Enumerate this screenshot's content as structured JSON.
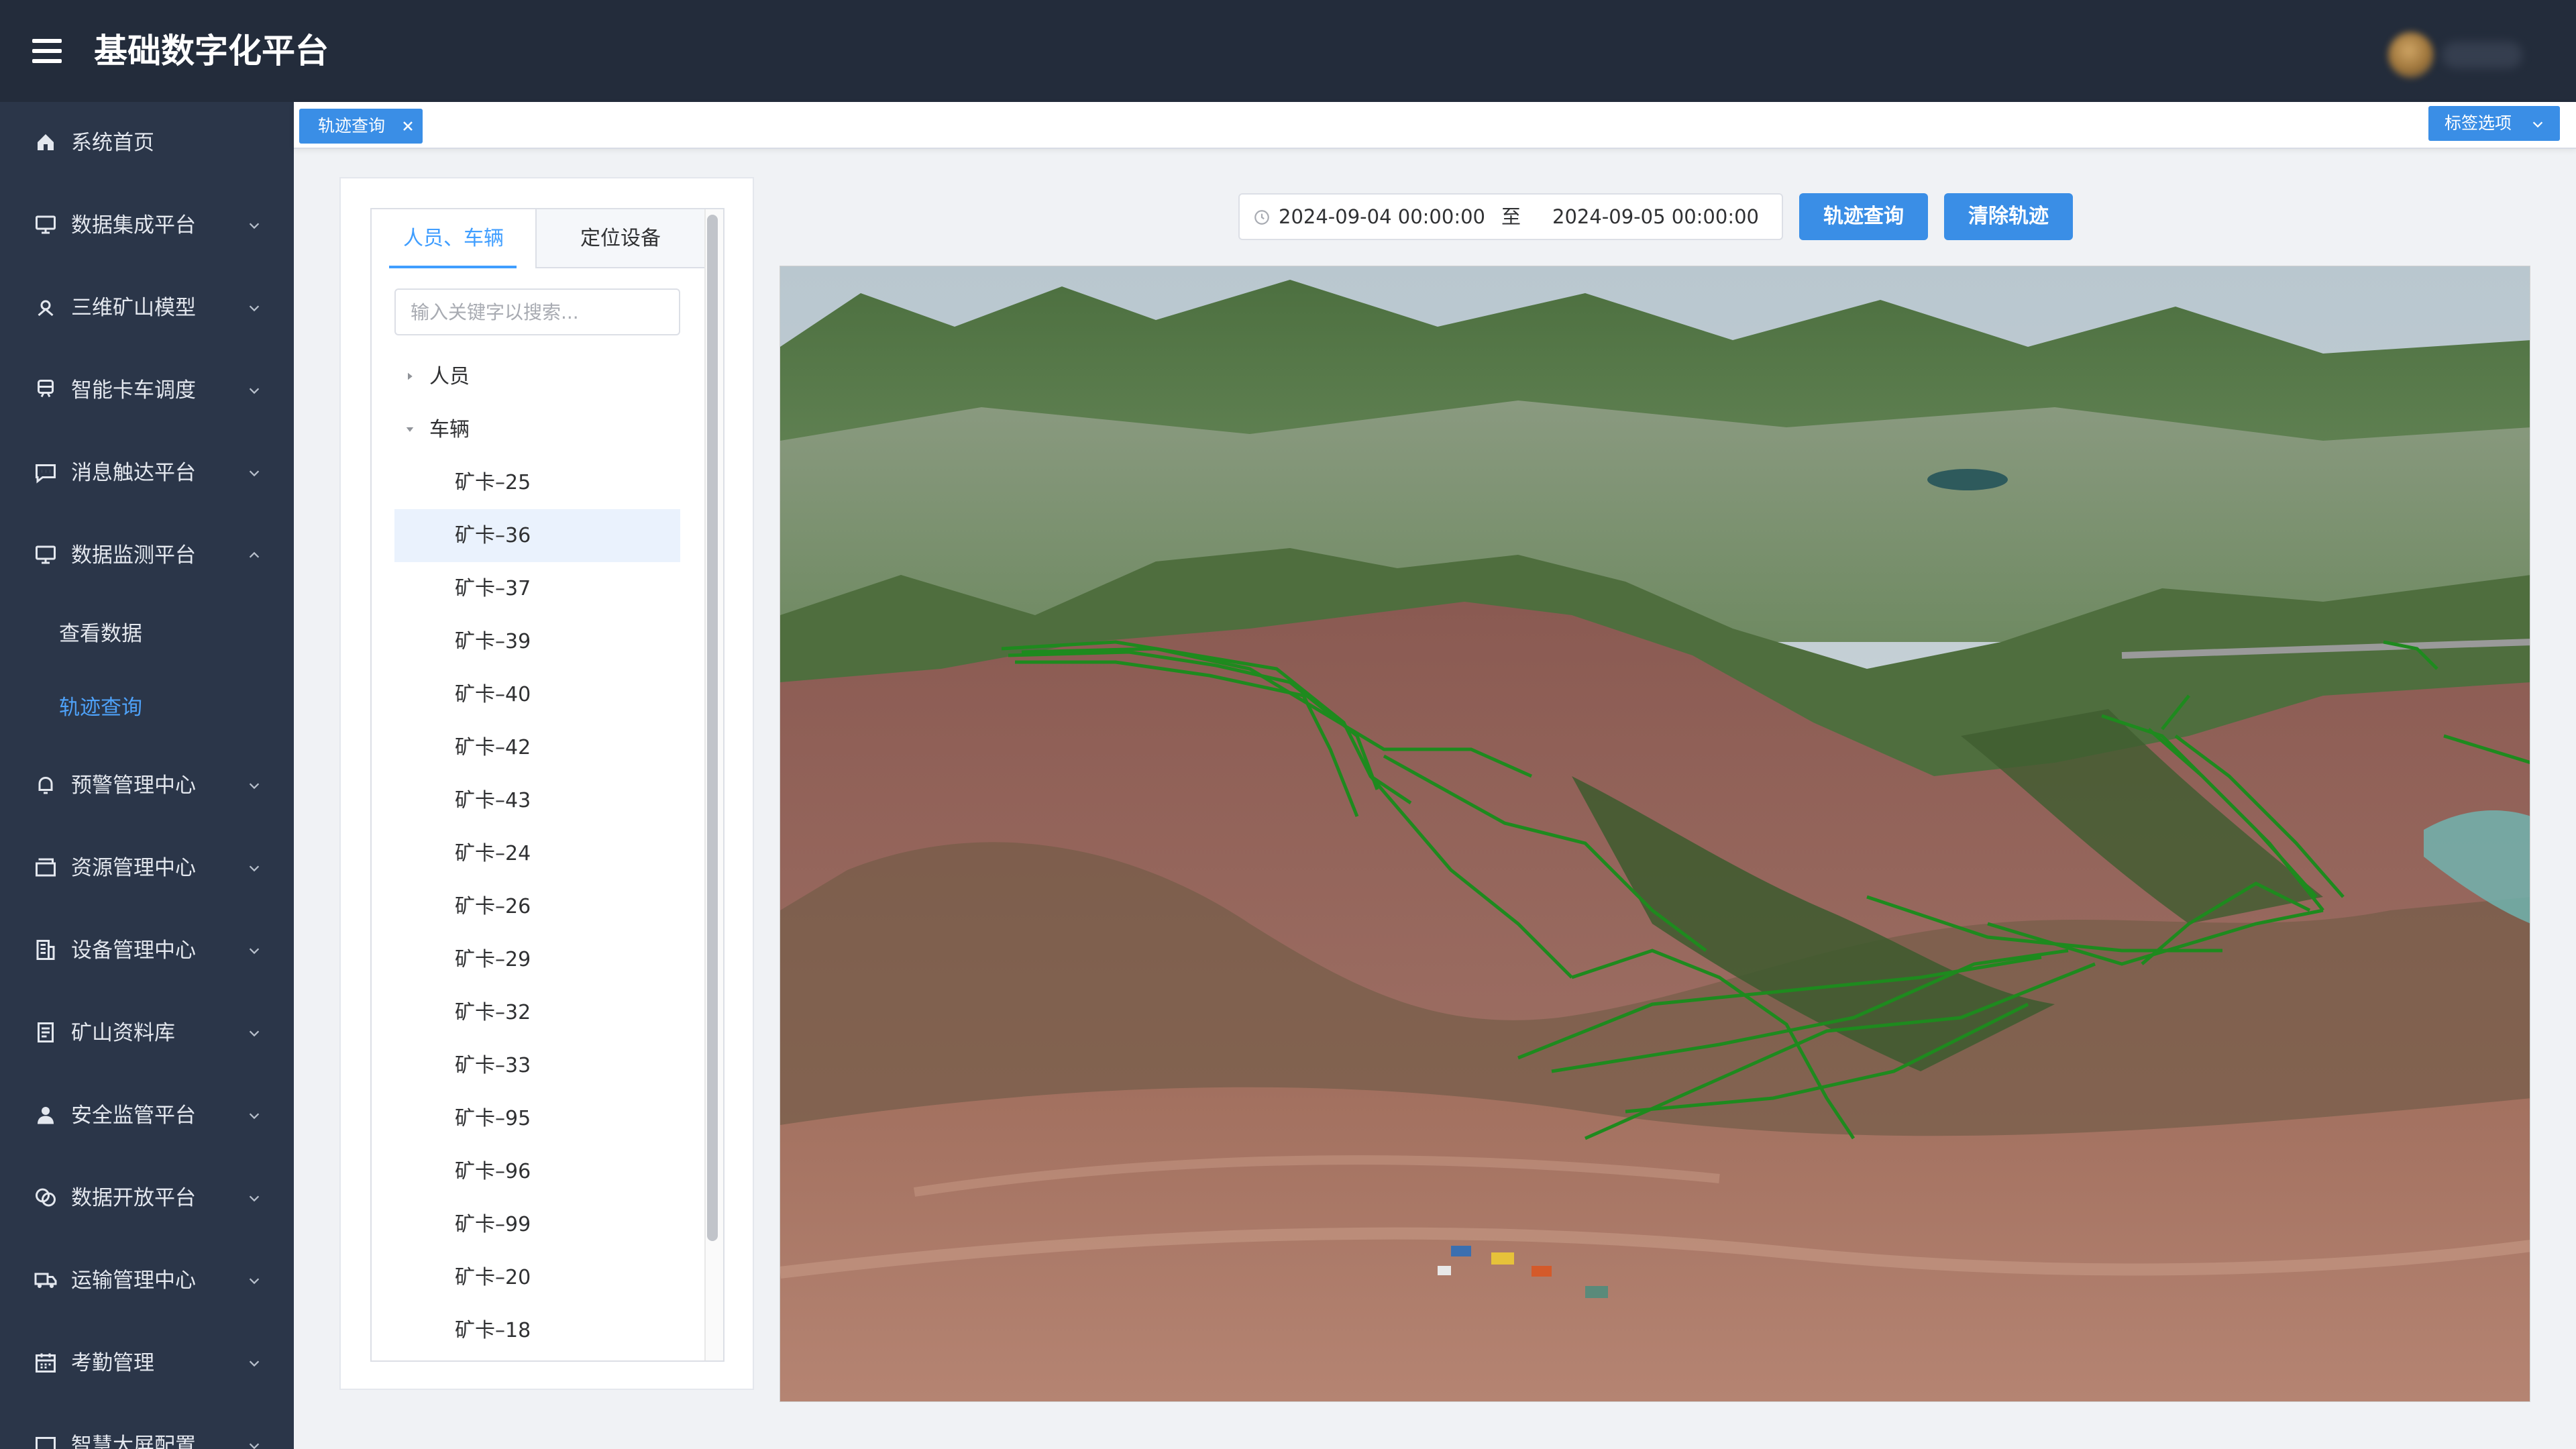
{
  "app": {
    "title": "基础数字化平台"
  },
  "sidebar": {
    "items": [
      {
        "label": "系统首页",
        "icon": "home-icon",
        "expandable": false
      },
      {
        "label": "数据集成平台",
        "icon": "monitor-icon",
        "expandable": true
      },
      {
        "label": "三维矿山模型",
        "icon": "map-pin-icon",
        "expandable": true
      },
      {
        "label": "智能卡车调度",
        "icon": "truck-dispatch-icon",
        "expandable": true
      },
      {
        "label": "消息触达平台",
        "icon": "message-icon",
        "expandable": true
      },
      {
        "label": "数据监测平台",
        "icon": "monitor-icon",
        "expandable": true,
        "expanded": true,
        "children": [
          {
            "label": "查看数据"
          },
          {
            "label": "轨迹查询",
            "active": true
          }
        ]
      },
      {
        "label": "预警管理中心",
        "icon": "bell-icon",
        "expandable": true
      },
      {
        "label": "资源管理中心",
        "icon": "box-icon",
        "expandable": true
      },
      {
        "label": "设备管理中心",
        "icon": "building-icon",
        "expandable": true
      },
      {
        "label": "矿山资料库",
        "icon": "document-icon",
        "expandable": true
      },
      {
        "label": "安全监管平台",
        "icon": "user-icon",
        "expandable": true
      },
      {
        "label": "数据开放平台",
        "icon": "layers-icon",
        "expandable": true
      },
      {
        "label": "运输管理中心",
        "icon": "truck-icon",
        "expandable": true
      },
      {
        "label": "考勤管理",
        "icon": "calendar-icon",
        "expandable": true
      },
      {
        "label": "智慧大屏配置",
        "icon": "screen-icon",
        "expandable": true
      }
    ]
  },
  "tags": {
    "active_tag": "轨迹查询",
    "options_label": "标签选项"
  },
  "panel": {
    "tabs": [
      {
        "label": "人员、车辆",
        "active": true
      },
      {
        "label": "定位设备",
        "active": false
      }
    ],
    "search_placeholder": "输入关键字以搜索...",
    "tree": [
      {
        "label": "人员",
        "level": 0,
        "expanded": false
      },
      {
        "label": "车辆",
        "level": 0,
        "expanded": true
      },
      {
        "label": "矿卡–25",
        "level": 1
      },
      {
        "label": "矿卡–36",
        "level": 1,
        "selected": true
      },
      {
        "label": "矿卡–37",
        "level": 1
      },
      {
        "label": "矿卡–39",
        "level": 1
      },
      {
        "label": "矿卡–40",
        "level": 1
      },
      {
        "label": "矿卡–42",
        "level": 1
      },
      {
        "label": "矿卡–43",
        "level": 1
      },
      {
        "label": "矿卡–24",
        "level": 1
      },
      {
        "label": "矿卡–26",
        "level": 1
      },
      {
        "label": "矿卡–29",
        "level": 1
      },
      {
        "label": "矿卡–32",
        "level": 1
      },
      {
        "label": "矿卡–33",
        "level": 1
      },
      {
        "label": "矿卡–95",
        "level": 1
      },
      {
        "label": "矿卡–96",
        "level": 1
      },
      {
        "label": "矿卡–99",
        "level": 1
      },
      {
        "label": "矿卡–20",
        "level": 1
      },
      {
        "label": "矿卡–18",
        "level": 1
      }
    ]
  },
  "toolbar": {
    "start_date": "2024-09-04 00:00:00",
    "separator": "至",
    "end_date": "2024-09-05 00:00:00",
    "query_label": "轨迹查询",
    "clear_label": "清除轨迹"
  },
  "map": {
    "track_color": "#1e8a1e",
    "clock_icon": "clock-icon"
  }
}
